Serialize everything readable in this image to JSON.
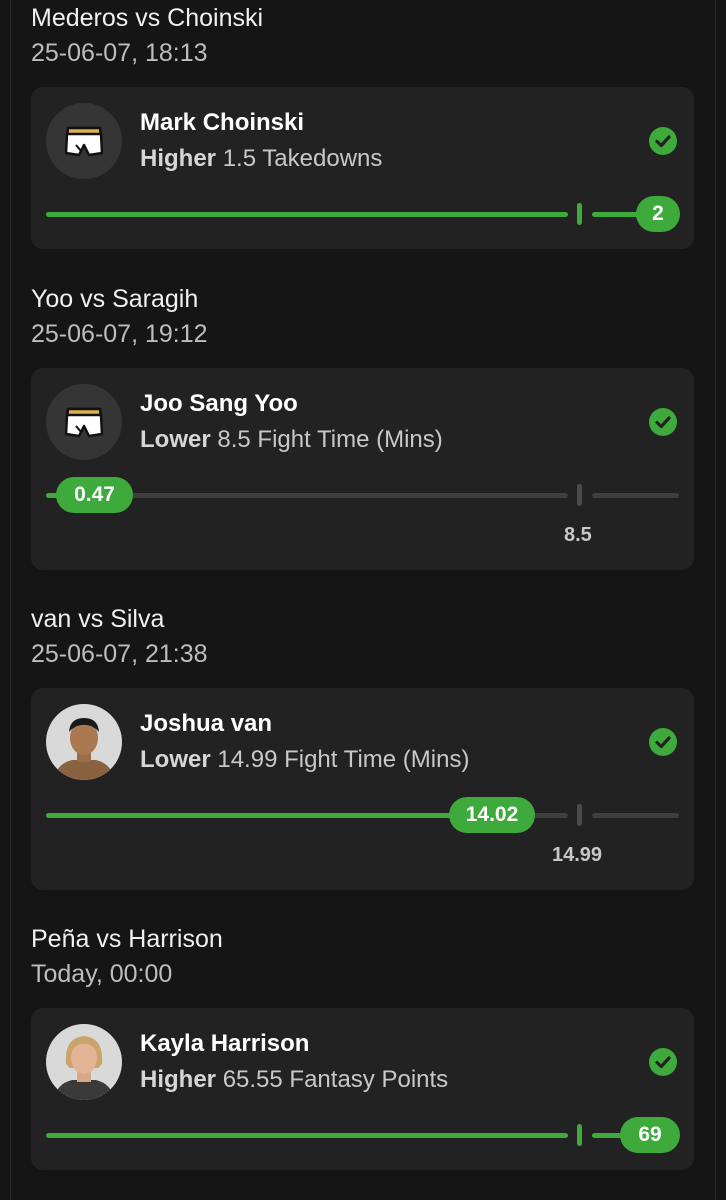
{
  "entries": [
    {
      "matchup": "Mederos vs Choinski",
      "datetime": "25-06-07, 18:13",
      "player": "Mark Choinski",
      "direction": "Higher",
      "line": "1.5",
      "stat": "Takedowns",
      "result": "2",
      "progress_fraction": 1.0,
      "avatar": "shorts-icon",
      "status": "won"
    },
    {
      "matchup": "Yoo vs Saragih",
      "datetime": "25-06-07, 19:12",
      "player": "Joo Sang Yoo",
      "direction": "Lower",
      "line": "8.5",
      "stat": "Fight Time (Mins)",
      "result": "0.47",
      "progress_fraction": 0.05,
      "avatar": "shorts-icon",
      "status": "won"
    },
    {
      "matchup": "van vs Silva",
      "datetime": "25-06-07, 21:38",
      "player": "Joshua van",
      "direction": "Lower",
      "line": "14.99",
      "stat": "Fight Time (Mins)",
      "result": "14.02",
      "progress_fraction": 0.74,
      "avatar": "fighter-photo",
      "status": "won"
    },
    {
      "matchup": "Peña vs Harrison",
      "datetime": "Today, 00:00",
      "player": "Kayla Harrison",
      "direction": "Higher",
      "line": "65.55",
      "stat": "Fantasy Points",
      "result": "69",
      "progress_fraction": 1.0,
      "avatar": "fighter-photo",
      "status": "won"
    }
  ],
  "colors": {
    "background": "#151515",
    "card": "#222222",
    "accent_green": "#3faa3c",
    "track_grey": "#3e3e3e"
  }
}
